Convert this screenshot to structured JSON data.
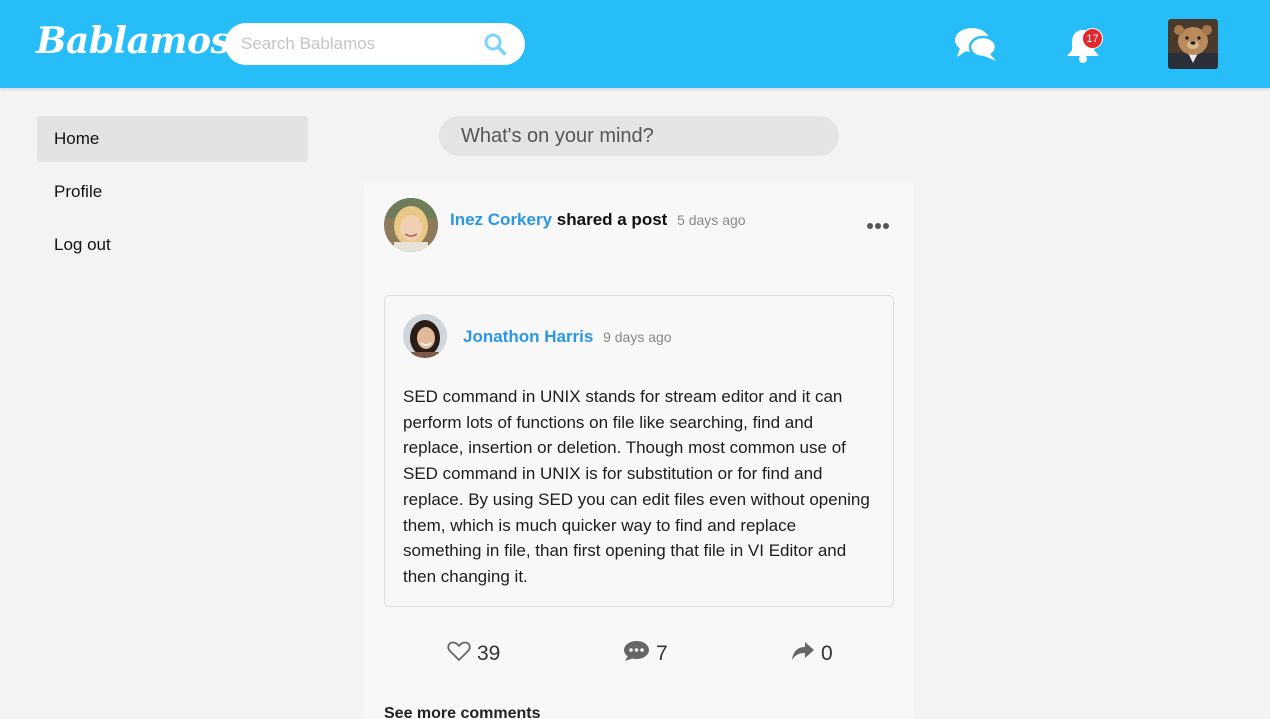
{
  "header": {
    "logo": "Bablamos",
    "search_placeholder": "Search Bablamos",
    "notifications_count": "17",
    "colors": {
      "bar": "#27bdf9",
      "badge": "#e0282f"
    }
  },
  "sidebar": {
    "items": [
      {
        "label": "Home",
        "active": true
      },
      {
        "label": "Profile",
        "active": false
      },
      {
        "label": "Log out",
        "active": false
      }
    ]
  },
  "composer": {
    "placeholder": "What's on your mind?"
  },
  "post": {
    "author": "Inez Corkery",
    "action": "shared a post",
    "time": "5 days ago",
    "shared": {
      "author": "Jonathon Harris",
      "time": "9 days ago",
      "body": "SED command in UNIX stands for stream editor and it can perform lots of functions on file like searching, find and replace, insertion or deletion. Though most common use of SED command in UNIX is for substitution or for find and replace. By using SED you can edit files even without opening them, which is much quicker way to find and replace something in file, than first opening that file in VI Editor and then changing it."
    },
    "likes": "39",
    "comments": "7",
    "shares": "0",
    "see_more": "See more comments"
  },
  "icons": [
    "search-icon",
    "chat-icon",
    "bell-icon",
    "more-icon",
    "heart-icon",
    "comment-icon",
    "share-icon"
  ]
}
